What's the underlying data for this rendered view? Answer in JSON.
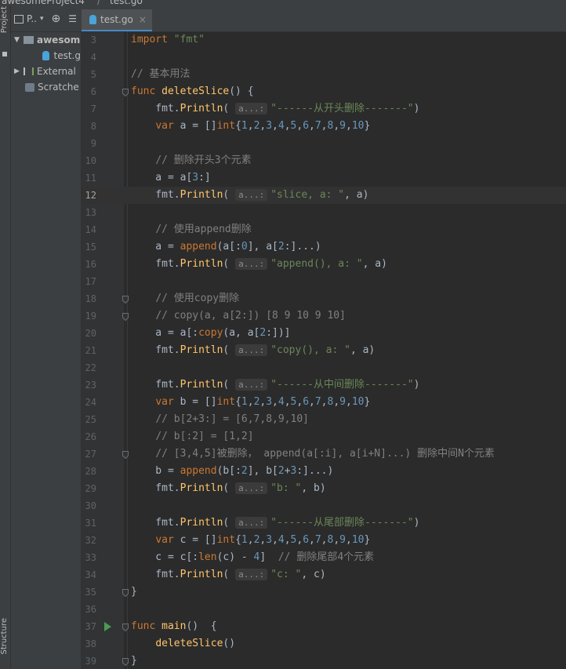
{
  "breadcrumb": {
    "project": "awesomeProject4",
    "file": "test.go"
  },
  "left_stripe": {
    "project_label": "Project",
    "structure_label": "Structure"
  },
  "project_panel": {
    "title": "P..",
    "tree": [
      {
        "label": "awesom",
        "type": "folder",
        "expanded": true
      },
      {
        "label": "test.g",
        "type": "go-file"
      },
      {
        "label": "External",
        "type": "library",
        "expanded": false
      },
      {
        "label": "Scratche",
        "type": "scratch"
      }
    ]
  },
  "editor_tab": {
    "label": "test.go",
    "close": "×"
  },
  "editor": {
    "current_line": 12,
    "lines": [
      {
        "n": "3",
        "html": "<span class=\"kw\">import</span> <span class=\"str\">\"fmt\"</span>"
      },
      {
        "n": "4",
        "html": ""
      },
      {
        "n": "5",
        "html": "<span class=\"cmt\">// 基本用法</span>"
      },
      {
        "n": "6",
        "html": "<span class=\"kw\">func</span> <span class=\"fn\">deleteSlice</span>() {"
      },
      {
        "n": "7",
        "html": "    fmt.<span class=\"method\">Println</span>( <span class=\"hint\">a...:</span><span class=\"str\">\"------从开头删除-------\"</span>)"
      },
      {
        "n": "8",
        "html": "    <span class=\"kw\">var</span> a = []<span class=\"kw\">int</span>{<span class=\"num\">1</span>,<span class=\"num\">2</span>,<span class=\"num\">3</span>,<span class=\"num\">4</span>,<span class=\"num\">5</span>,<span class=\"num\">6</span>,<span class=\"num\">7</span>,<span class=\"num\">8</span>,<span class=\"num\">9</span>,<span class=\"num\">10</span>}"
      },
      {
        "n": "9",
        "html": ""
      },
      {
        "n": "10",
        "html": "    <span class=\"cmt\">// 删除开头3个元素</span>"
      },
      {
        "n": "11",
        "html": "    a = a[<span class=\"num\">3</span>:]"
      },
      {
        "n": "12",
        "html": "    fmt.<span class=\"method\">Println</span>( <span class=\"hint\">a...:</span><span class=\"str\">\"slice, a: \"</span>, a)"
      },
      {
        "n": "13",
        "html": ""
      },
      {
        "n": "14",
        "html": "    <span class=\"cmt\">// 使用append删除</span>"
      },
      {
        "n": "15",
        "html": "    a = <span class=\"kw\">append</span>(a[:<span class=\"num\">0</span>], a[<span class=\"num\">2</span>:]...)"
      },
      {
        "n": "16",
        "html": "    fmt.<span class=\"method\">Println</span>( <span class=\"hint\">a...:</span><span class=\"str\">\"append(), a: \"</span>, a)"
      },
      {
        "n": "17",
        "html": ""
      },
      {
        "n": "18",
        "html": "    <span class=\"cmt\">// 使用copy删除</span>"
      },
      {
        "n": "19",
        "html": "    <span class=\"cmt\">// copy(a, a[2:]) [8 9 10 9 10]</span>"
      },
      {
        "n": "20",
        "html": "    a = a[:<span class=\"kw\">copy</span>(a, a[<span class=\"num\">2</span>:])]"
      },
      {
        "n": "21",
        "html": "    fmt.<span class=\"method\">Println</span>( <span class=\"hint\">a...:</span><span class=\"str\">\"copy(), a: \"</span>, a)"
      },
      {
        "n": "22",
        "html": ""
      },
      {
        "n": "23",
        "html": "    fmt.<span class=\"method\">Println</span>( <span class=\"hint\">a...:</span><span class=\"str\">\"------从中间删除-------\"</span>)"
      },
      {
        "n": "24",
        "html": "    <span class=\"kw\">var</span> b = []<span class=\"kw\">int</span>{<span class=\"num\">1</span>,<span class=\"num\">2</span>,<span class=\"num\">3</span>,<span class=\"num\">4</span>,<span class=\"num\">5</span>,<span class=\"num\">6</span>,<span class=\"num\">7</span>,<span class=\"num\">8</span>,<span class=\"num\">9</span>,<span class=\"num\">10</span>}"
      },
      {
        "n": "25",
        "html": "    <span class=\"cmt\">// b[2+3:] = [6,7,8,9,10]</span>"
      },
      {
        "n": "26",
        "html": "    <span class=\"cmt\">// b[:2] = [1,2]</span>"
      },
      {
        "n": "27",
        "html": "    <span class=\"cmt\">// [3,4,5]被删除， append(a[:i], a[i+N]...) 删除中间N个元素</span>"
      },
      {
        "n": "28",
        "html": "    b = <span class=\"kw\">append</span>(b[:<span class=\"num\">2</span>], b[<span class=\"num\">2</span>+<span class=\"num\">3</span>:]...)"
      },
      {
        "n": "29",
        "html": "    fmt.<span class=\"method\">Println</span>( <span class=\"hint\">a...:</span><span class=\"str\">\"b: \"</span>, b)"
      },
      {
        "n": "30",
        "html": ""
      },
      {
        "n": "31",
        "html": "    fmt.<span class=\"method\">Println</span>( <span class=\"hint\">a...:</span><span class=\"str\">\"------从尾部删除-------\"</span>)"
      },
      {
        "n": "32",
        "html": "    <span class=\"kw\">var</span> c = []<span class=\"kw\">int</span>{<span class=\"num\">1</span>,<span class=\"num\">2</span>,<span class=\"num\">3</span>,<span class=\"num\">4</span>,<span class=\"num\">5</span>,<span class=\"num\">6</span>,<span class=\"num\">7</span>,<span class=\"num\">8</span>,<span class=\"num\">9</span>,<span class=\"num\">10</span>}"
      },
      {
        "n": "33",
        "html": "    c = c[:<span class=\"kw\">len</span>(c) - <span class=\"num\">4</span>]  <span class=\"cmt\">// 删除尾部4个元素</span>"
      },
      {
        "n": "34",
        "html": "    fmt.<span class=\"method\">Println</span>( <span class=\"hint\">a...:</span><span class=\"str\">\"c: \"</span>, c)"
      },
      {
        "n": "35",
        "html": "}"
      },
      {
        "n": "36",
        "html": ""
      },
      {
        "n": "37",
        "html": "<span class=\"kw\">func</span> <span class=\"fn\">main</span>()  {"
      },
      {
        "n": "38",
        "html": "    <span class=\"method\">deleteSlice</span>()"
      },
      {
        "n": "39",
        "html": "}"
      }
    ]
  },
  "colors": {
    "background": "#2b2b2b",
    "keyword": "#cc7832",
    "string": "#6a8759",
    "number": "#6897bb",
    "comment": "#808080",
    "function": "#ffc66d",
    "run_gutter": "#499c54"
  }
}
